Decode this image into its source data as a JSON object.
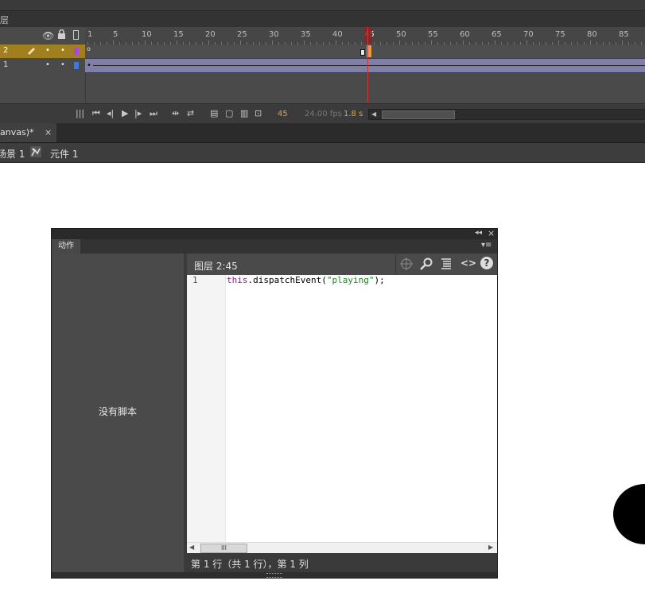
{
  "timeline": {
    "header_fragment": "层",
    "ruler_numbers": [
      "1",
      "5",
      "10",
      "15",
      "20",
      "25",
      "30",
      "35",
      "40",
      "45",
      "50",
      "55",
      "60",
      "65",
      "70",
      "75",
      "80",
      "85"
    ],
    "layers": [
      {
        "name": "2",
        "color": "#a64dd6",
        "selected": true
      },
      {
        "name": "1",
        "color": "#3d7bd9",
        "selected": false
      }
    ],
    "current_frame": "45",
    "fps": "24.00 fps",
    "elapsed": "1.8 s",
    "accent": "#e0a23a"
  },
  "document": {
    "tab_label": "anvas)*",
    "close_glyph": "×",
    "scene_label": "场景 1",
    "symbol_label": "元件 1"
  },
  "actions_panel": {
    "tab_label": "动作",
    "no_script": "没有脚本",
    "location": "图层 2:45",
    "code_lines": [
      {
        "num": "1",
        "code_keyword": "this",
        "code_rest": ".dispatchEvent(",
        "code_string": "\"playing\"",
        "code_end": ");"
      }
    ],
    "status": "第 1 行（共 1 行），第 1 列",
    "scroll_thumb": "III"
  },
  "icons": {
    "eye": "eye-icon",
    "lock": "lock-icon",
    "outline": "outline-icon",
    "pencil": "pencil-icon",
    "collapse": "collapse-icon",
    "close": "close-icon",
    "menu": "panel-menu-icon",
    "target": "target-icon",
    "find": "find-icon",
    "format": "format-icon",
    "code": "code-snippet-icon",
    "help": "help-icon"
  }
}
